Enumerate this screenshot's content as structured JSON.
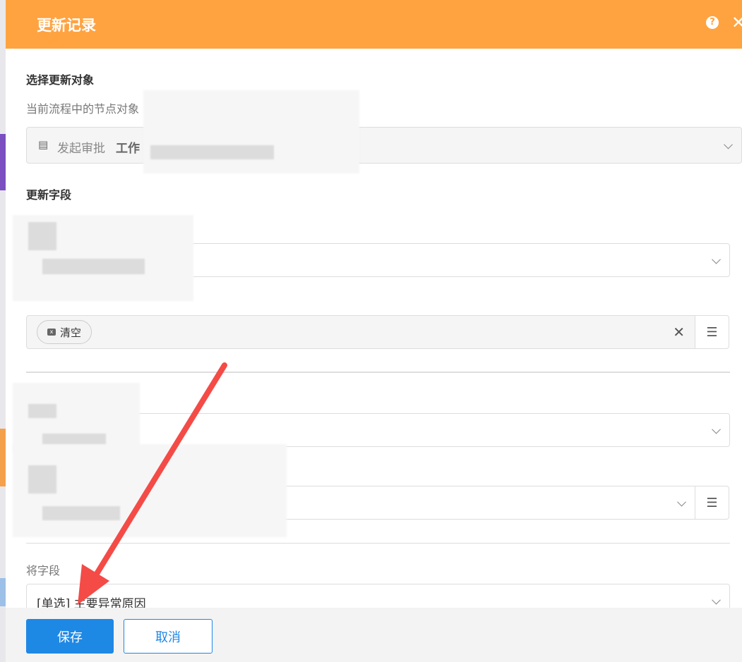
{
  "dialog": {
    "title": "更新记录",
    "help_icon": "question-circle-icon",
    "close_icon": "close-icon"
  },
  "target": {
    "section_title": "选择更新对象",
    "hint": "当前流程中的节点对象",
    "select_value_prefix": "发起审批",
    "select_value_bold": "工作"
  },
  "fields": {
    "section_title": "更新字段",
    "clear_tag": "清空",
    "to_field_label": "将字段",
    "to_field_value": "[单选] 主要异常原因"
  },
  "footer": {
    "save": "保存",
    "cancel": "取消"
  },
  "colors": {
    "header": "#FFA340",
    "primary": "#1E88E5",
    "annotation_arrow": "#F44B47"
  }
}
